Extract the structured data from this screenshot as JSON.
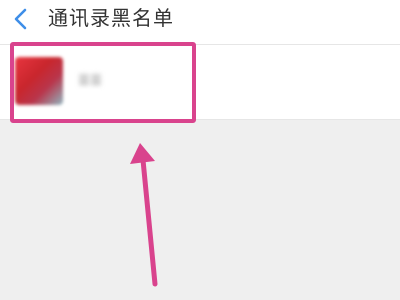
{
  "nav": {
    "title": "通讯录黑名单",
    "back_icon": "chevron-left-icon"
  },
  "contacts": [
    {
      "name": "苗苗"
    }
  ],
  "colors": {
    "accent": "#3e8ee8",
    "annotation": "#d9438d",
    "background": "#efefef"
  }
}
